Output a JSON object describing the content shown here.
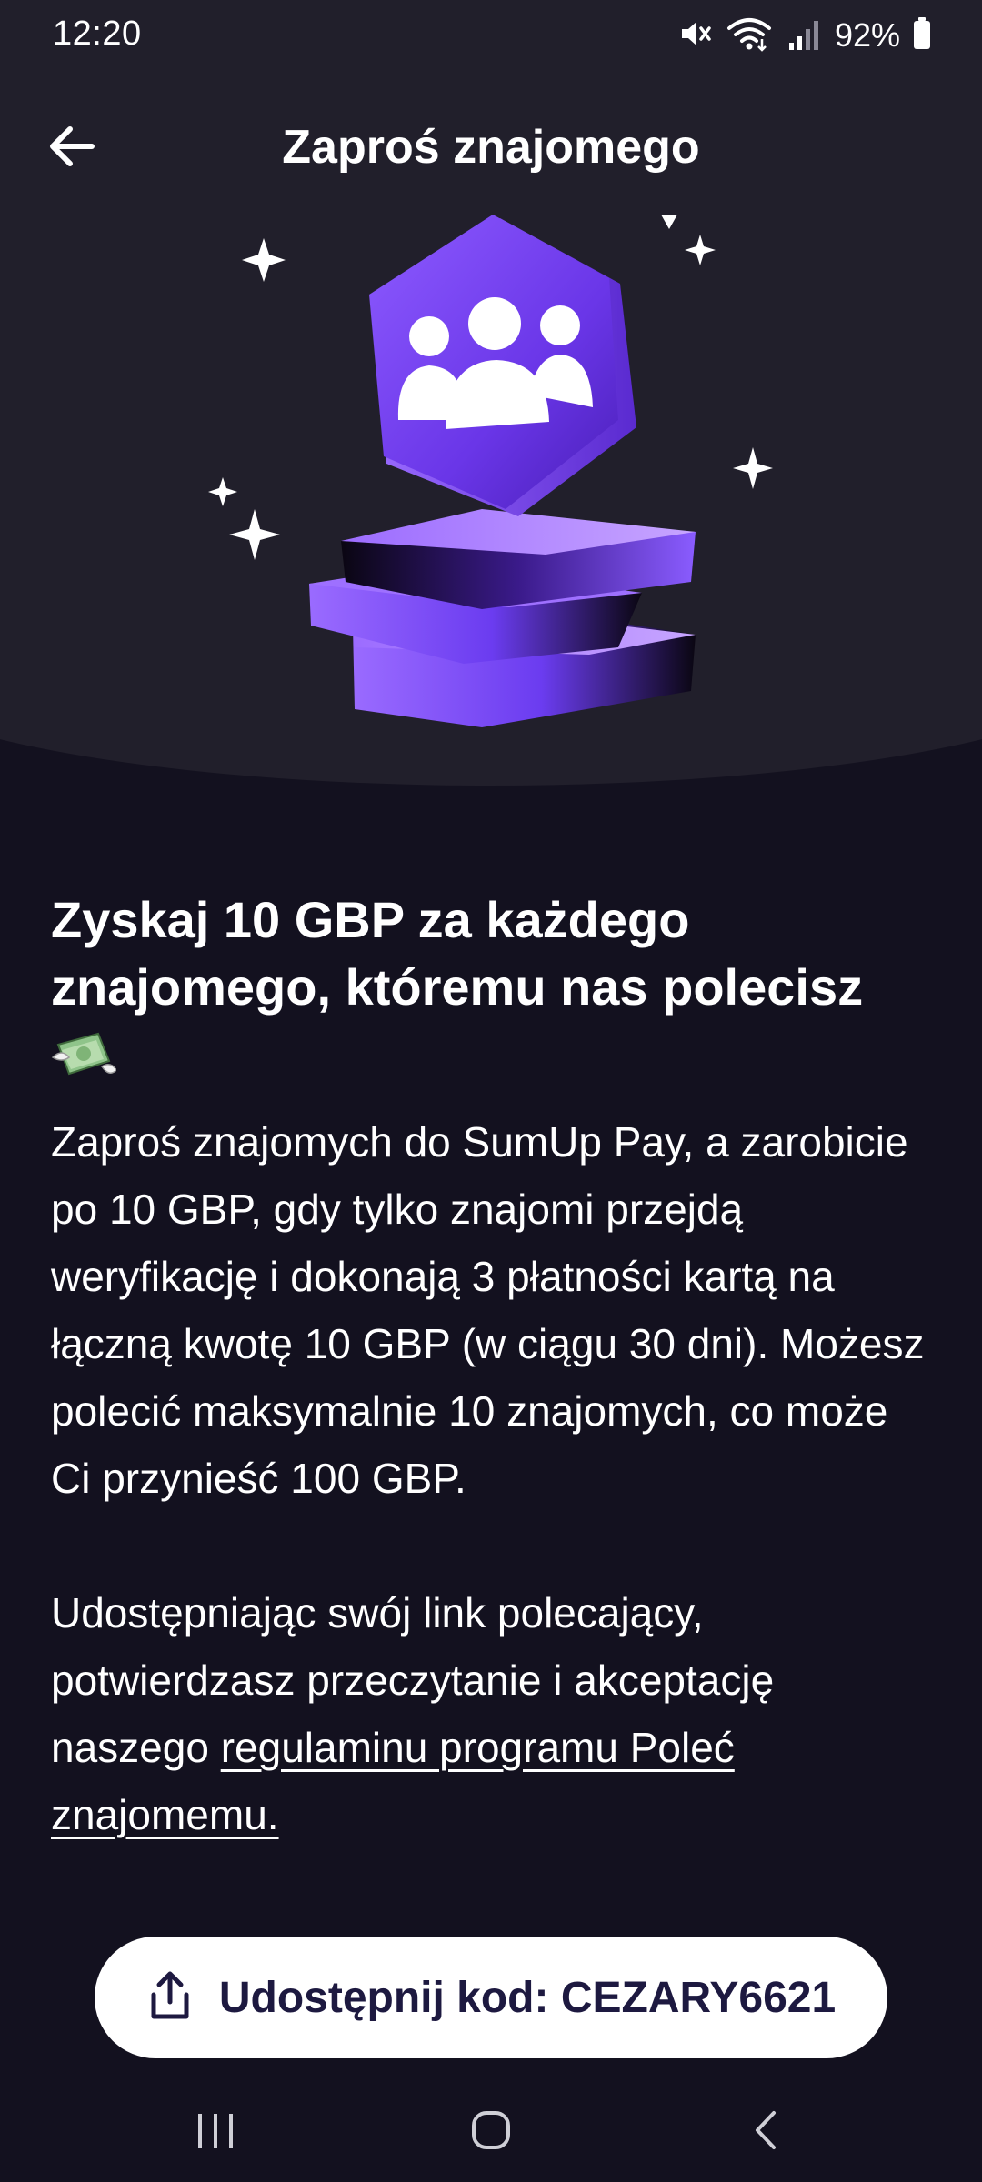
{
  "status_bar": {
    "time": "12:20",
    "battery_percent": "92%",
    "icons": [
      "mute-icon",
      "wifi-icon",
      "signal-icon",
      "battery-icon"
    ]
  },
  "header": {
    "title": "Zaproś znajomego",
    "back_icon": "arrow-left-icon"
  },
  "illustration": {
    "icon": "people-group-icon",
    "accent_color": "#7b4cf5"
  },
  "main": {
    "headline": "Zyskaj 10 GBP za każdego znajomego, któremu nas polecisz",
    "emoji_icon": "money-with-wings-icon",
    "description": "Zaproś znajomych do SumUp Pay, a zarobicie po 10 GBP, gdy tylko znajomi przejdą weryfikację i dokonają 3 płatności kartą na łączną kwotę 10 GBP (w ciągu 30 dni). Możesz polecić maksymalnie 10 znajomych, co może Ci przynieść 100 GBP.",
    "terms_prefix": "Udostępniając swój link polecający, potwierdzasz przeczytanie i akceptację naszego ",
    "terms_link": "regulaminu programu Poleć znajomemu. "
  },
  "share_button": {
    "label": "Udostępnij kod: CEZARY6621",
    "icon": "share-icon"
  },
  "nav_bar": {
    "icons": [
      "recent-apps-icon",
      "home-icon",
      "back-icon"
    ]
  },
  "colors": {
    "background": "#13111f",
    "hero_background": "#211f2b",
    "button_background": "#ffffff",
    "button_text": "#1d1940",
    "accent": "#7b4cf5"
  }
}
